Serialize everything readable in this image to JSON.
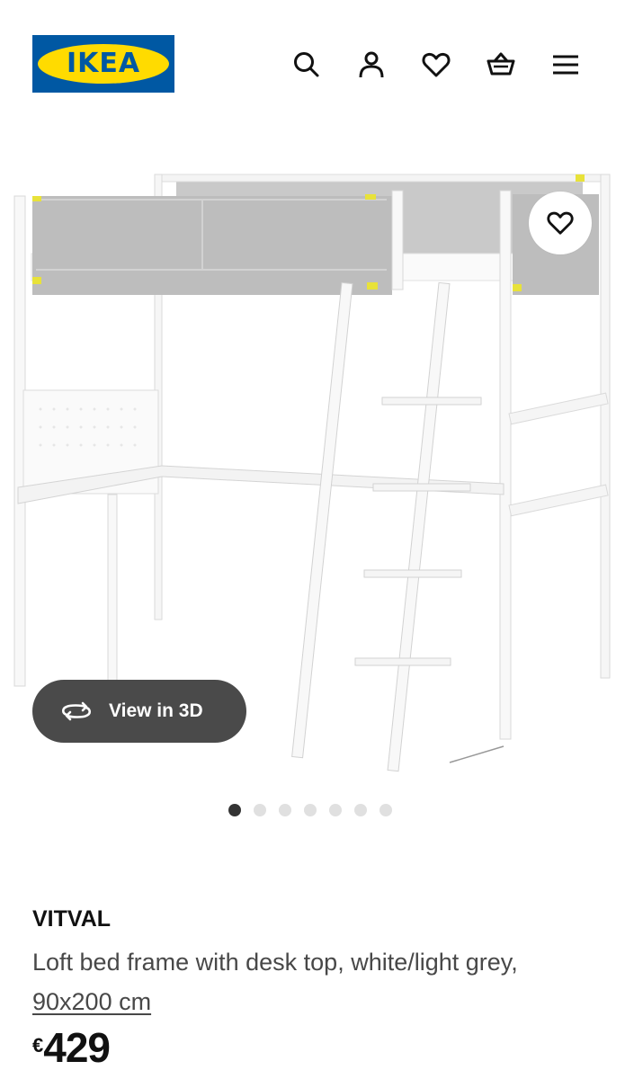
{
  "header": {
    "logo_text": "IKEA",
    "icons": [
      "search-icon",
      "user-icon",
      "heart-icon",
      "basket-icon",
      "menu-icon"
    ]
  },
  "gallery": {
    "view_3d_label": "View in 3D",
    "total_images": 7,
    "active_image": 1
  },
  "product": {
    "name": "VITVAL",
    "description": "Loft bed frame with desk top, white/light grey,",
    "size": "90x200 cm",
    "currency": "€",
    "price": "429"
  },
  "colors": {
    "ikea_blue": "#0058a3",
    "ikea_yellow": "#ffdb00",
    "view3d_bg": "#4a4a4a"
  }
}
